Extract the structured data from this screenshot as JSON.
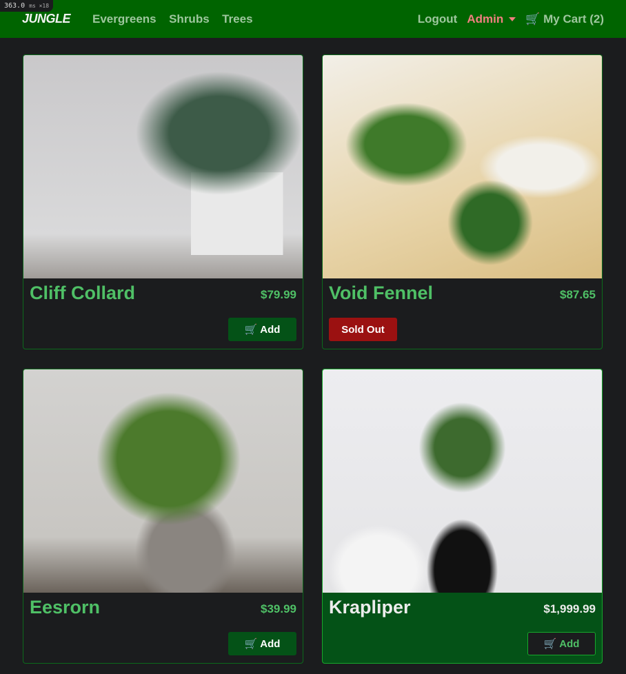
{
  "debug": {
    "value": "363.0",
    "unit": "ms ×18"
  },
  "nav": {
    "brand": "JUNGLE",
    "links": [
      "Evergreens",
      "Shrubs",
      "Trees"
    ],
    "logout": "Logout",
    "admin": "Admin",
    "cart": "My Cart (2)"
  },
  "products": [
    {
      "name": "Cliff Collard",
      "price": "$79.99",
      "action": "Add"
    },
    {
      "name": "Void Fennel",
      "price": "$87.65",
      "action": "Sold Out"
    },
    {
      "name": "Eesrorn",
      "price": "$39.99",
      "action": "Add"
    },
    {
      "name": "Krapliper",
      "price": "$1,999.99",
      "action": "Add"
    }
  ]
}
